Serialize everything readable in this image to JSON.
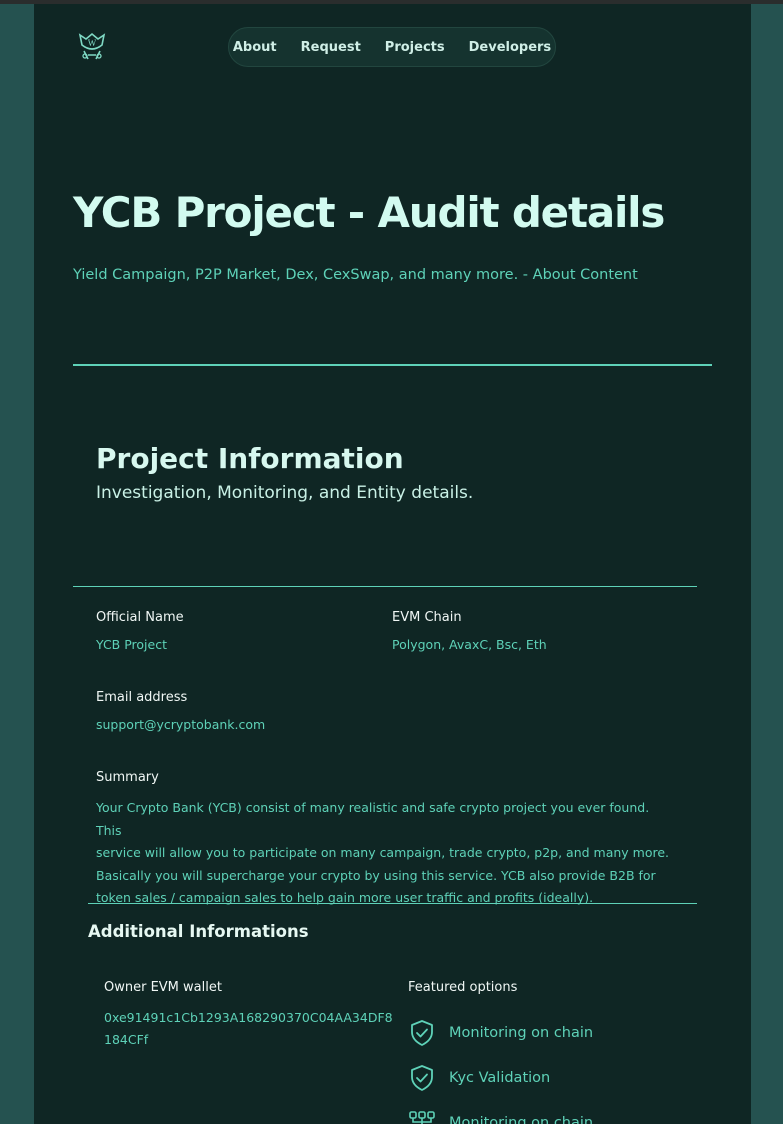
{
  "nav": {
    "logo": "ycb-logo",
    "items": [
      "About",
      "Request",
      "Projects",
      "Developers"
    ]
  },
  "hero": {
    "title": "YCB Project - Audit details",
    "subtitle": "Yield Campaign, P2P Market, Dex, CexSwap, and many more. - About Content"
  },
  "project_info": {
    "title": "Project Information",
    "subtitle": "Investigation, Monitoring, and Entity details.",
    "official_name_label": "Official Name",
    "official_name": "YCB Project",
    "evm_chain_label": "EVM Chain",
    "evm_chain": "Polygon, AvaxC, Bsc, Eth",
    "email_label": "Email address",
    "email": "support@ycryptobank.com",
    "summary_label": "Summary",
    "summary_lines": [
      "Your Crypto Bank (YCB) consist of many realistic and safe crypto project you ever found. This",
      "service will allow you to participate on many campaign, trade crypto, p2p, and many more.",
      "Basically you will supercharge your crypto by using this service. YCB also provide B2B for",
      "token sales / campaign sales to help gain more user traffic and profits (ideally)."
    ]
  },
  "additional": {
    "title": "Additional Informations",
    "wallet_label": "Owner EVM wallet",
    "wallet": "0xe91491c1Cb1293A168290370C04AA34DF8184CFf",
    "featured_label": "Featured options",
    "features": [
      {
        "label": "Monitoring on chain",
        "icon": "shield-check-icon"
      },
      {
        "label": "Kyc Validation",
        "icon": "shield-check-icon"
      },
      {
        "label": "Monitoring on chain",
        "icon": "network-icon"
      }
    ]
  },
  "colors": {
    "background": "#0f2624",
    "accent": "#5ed2b8",
    "heading": "#d2fbf0"
  }
}
